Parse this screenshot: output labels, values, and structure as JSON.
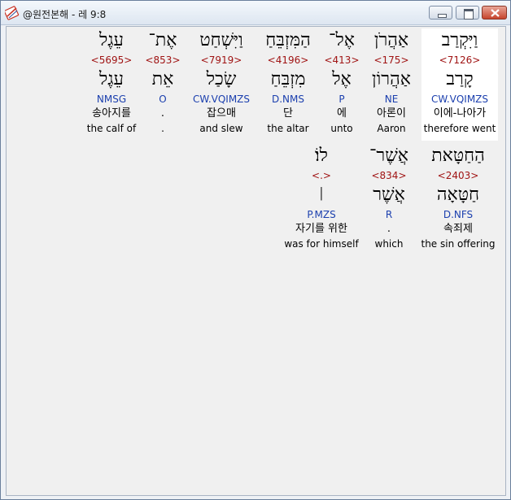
{
  "window": {
    "title": "@원전본해 - 레 9:8",
    "icon": "bible-app-icon",
    "colors": {
      "strong_number": "#a01414",
      "morph_code": "#1b3fae",
      "selected_bg": "#ffffff"
    }
  },
  "line1": [
    {
      "heb": "וַיִּקְרַב",
      "strong": "<7126>",
      "lemma": "קָרַב",
      "morph": "CW.VQIMZS",
      "kor": "이에-나아가",
      "eng": "therefore went",
      "selected": true
    },
    {
      "heb": "אַהֲרֹן",
      "strong": "<175>",
      "lemma": "אַהֲרוֹן",
      "morph": "NE",
      "kor": "아론이",
      "eng": "Aaron"
    },
    {
      "heb": "אֶל־",
      "strong": "<413>",
      "lemma": "אֶל",
      "morph": "P",
      "kor": "에",
      "eng": "unto"
    },
    {
      "heb": "הַמִּזְבֵּחַ",
      "strong": "<4196>",
      "lemma": "מִזְבֵּחַ",
      "morph": "D.NMS",
      "kor": "단",
      "eng": "the altar"
    },
    {
      "heb": "וַיִּשְׁחַט",
      "strong": "<7919>",
      "lemma": "שָׂכַל",
      "morph": "CW.VQIMZS",
      "kor": "잡으매",
      "eng": "and slew"
    },
    {
      "heb": "אֶת־",
      "strong": "<853>",
      "lemma": "אֵת",
      "morph": "O",
      "kor": ".",
      "eng": "."
    },
    {
      "heb": "עֵגֶל",
      "strong": "<5695>",
      "lemma": "עֵגֶל",
      "morph": "NMSG",
      "kor": "송아지를",
      "eng": "the calf of"
    }
  ],
  "line2": [
    {
      "heb": "הַחַטָּאת",
      "strong": "<2403>",
      "lemma": "חַטָּאָה",
      "morph": "D.NFS",
      "kor": "속죄제",
      "eng": "the sin offering"
    },
    {
      "heb": "אֲשֶׁר־",
      "strong": "<834>",
      "lemma": "אֲשֶׁר",
      "morph": "R",
      "kor": ".",
      "eng": "which"
    },
    {
      "heb": "לוֹ׃",
      "strong": "<.>",
      "lemma": "׀",
      "morph": "P.MZS",
      "kor": "자기를 위한",
      "eng": "was for himself"
    }
  ]
}
